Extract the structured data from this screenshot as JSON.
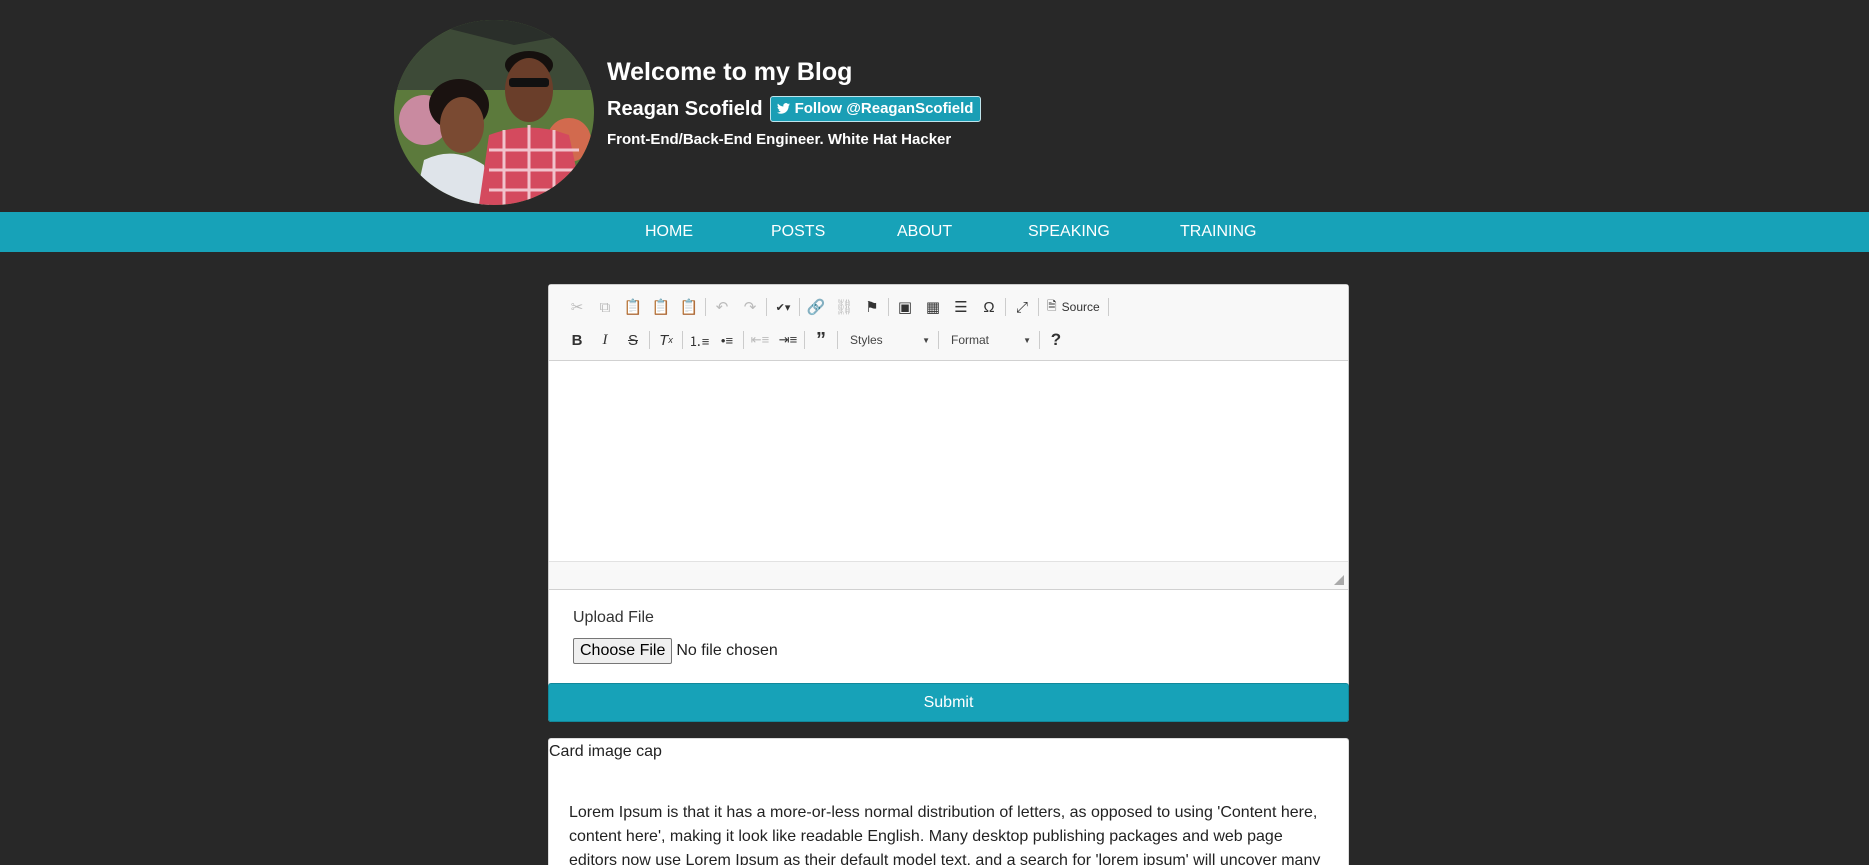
{
  "header": {
    "blog_title": "Welcome to my Blog",
    "author_name": "Reagan Scofield",
    "follow_label": "Follow @ReaganScofield",
    "tagline": "Front-End/Back-End Engineer. White Hat Hacker"
  },
  "nav": {
    "items": [
      "HOME",
      "POSTS",
      "ABOUT",
      "SPEAKING",
      "TRAINING"
    ]
  },
  "editor": {
    "toolbar_row1": [
      "cut",
      "copy",
      "paste",
      "paste-as-text",
      "paste-from-word",
      "undo",
      "redo",
      "spellcheck",
      "link",
      "unlink",
      "anchor",
      "image",
      "table",
      "horizontal-line",
      "special-character",
      "maximize"
    ],
    "source_label": "Source",
    "styles_label": "Styles",
    "format_label": "Format",
    "help_label": "?"
  },
  "upload": {
    "label": "Upload File",
    "button_label": "Choose File",
    "status": "No file chosen"
  },
  "submit_label": "Submit",
  "post": {
    "image_alt": "Card image cap",
    "text": "Lorem Ipsum is that it has a more-or-less normal distribution of letters, as opposed to using 'Content here, content here', making it look like readable English. Many desktop publishing packages and web page editors now use Lorem Ipsum as their default model text, and a search for 'lorem ipsum' will uncover many"
  },
  "colors": {
    "background": "#282828",
    "accent": "#17a2b8"
  }
}
